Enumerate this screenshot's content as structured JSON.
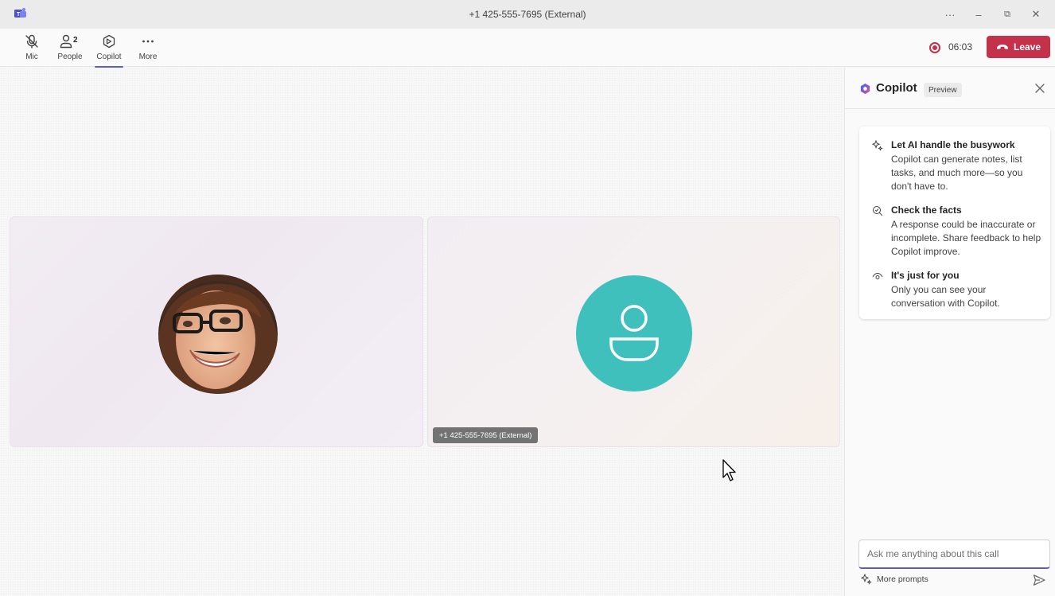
{
  "window": {
    "title": "+1 425-555-7695 (External)",
    "app_icon": "teams-icon",
    "controls": [
      "more-options-icon",
      "minimize-icon",
      "restore-icon",
      "close-icon"
    ],
    "more_glyph": "···",
    "minimize_glyph": "–",
    "restore_glyph": "⧉",
    "close_glyph": "✕"
  },
  "toolbar": {
    "items": [
      {
        "label": "Mic",
        "icon": "mic-off-icon"
      },
      {
        "label": "People",
        "icon": "people-icon",
        "count": "2"
      },
      {
        "label": "Copilot",
        "icon": "copilot-icon",
        "active": true
      },
      {
        "label": "More",
        "icon": "more-icon"
      }
    ],
    "timer": "06:03",
    "leave_label": "Leave",
    "accent": "#5b5fc7",
    "leave_color": "#c4314b"
  },
  "stage": {
    "participants": [
      {
        "type": "photo",
        "icon": "participant-photo"
      },
      {
        "type": "default-avatar",
        "icon": "person-icon",
        "name_tag": "+1 425-555-7695 (External)",
        "avatar_color": "#3fc0bd"
      }
    ]
  },
  "copilot": {
    "title": "Copilot",
    "badge": "Preview",
    "tips": [
      {
        "icon": "sparkle-icon",
        "title": "Let AI handle the busywork",
        "body": "Copilot can generate notes, list tasks, and much more—so you don't have to."
      },
      {
        "icon": "search-check-icon",
        "title": "Check the facts",
        "body": "A response could be inaccurate or incomplete. Share feedback to help Copilot improve."
      },
      {
        "icon": "eye-icon",
        "title": "It's just for you",
        "body": "Only you can see your conversation with Copilot."
      }
    ],
    "input_placeholder": "Ask me anything about this call",
    "more_prompts_label": "More prompts"
  }
}
